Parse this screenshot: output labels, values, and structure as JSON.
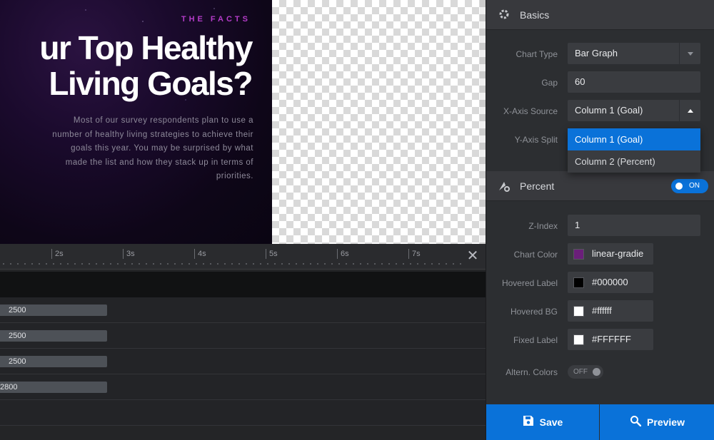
{
  "slide": {
    "eyebrow": "THE FACTS",
    "headline_line1": "ur Top Healthy",
    "headline_line2": "Living Goals?",
    "body": "Most of our survey respondents plan to use a number of healthy living strategies to achieve their goals this year. You may be surprised by what made the list and how they stack up in terms of priorities."
  },
  "timeline": {
    "ticks": [
      "2s",
      "3s",
      "4s",
      "5s",
      "6s",
      "7s"
    ],
    "rows": [
      {
        "value": "2500"
      },
      {
        "value": "2500"
      },
      {
        "value": "2500"
      },
      {
        "value": "2800"
      }
    ]
  },
  "panel": {
    "basics": {
      "title": "Basics",
      "chart_type_label": "Chart Type",
      "chart_type_value": "Bar Graph",
      "gap_label": "Gap",
      "gap_value": "60",
      "x_axis_source_label": "X-Axis Source",
      "x_axis_source_value": "Column 1 (Goal)",
      "y_axis_split_label": "Y-Axis Split",
      "x_axis_options": [
        "Column 1 (Goal)",
        "Column 2 (Percent)"
      ]
    },
    "percent": {
      "title": "Percent",
      "toggle": "ON",
      "z_index_label": "Z-Index",
      "z_index_value": "1",
      "chart_color_label": "Chart Color",
      "chart_color_value": "linear-gradie",
      "chart_color_swatch": "#6b1f7a",
      "hovered_label_label": "Hovered Label",
      "hovered_label_value": "#000000",
      "hovered_bg_label": "Hovered BG",
      "hovered_bg_value": "#ffffff",
      "fixed_label_label": "Fixed Label",
      "fixed_label_value": "#FFFFFF",
      "altern_colors_label": "Altern. Colors",
      "altern_colors_value": "OFF"
    },
    "save_label": "Save",
    "preview_label": "Preview"
  },
  "colors": {
    "accent": "#0a72d9",
    "panel_bg": "#2c2e31"
  }
}
